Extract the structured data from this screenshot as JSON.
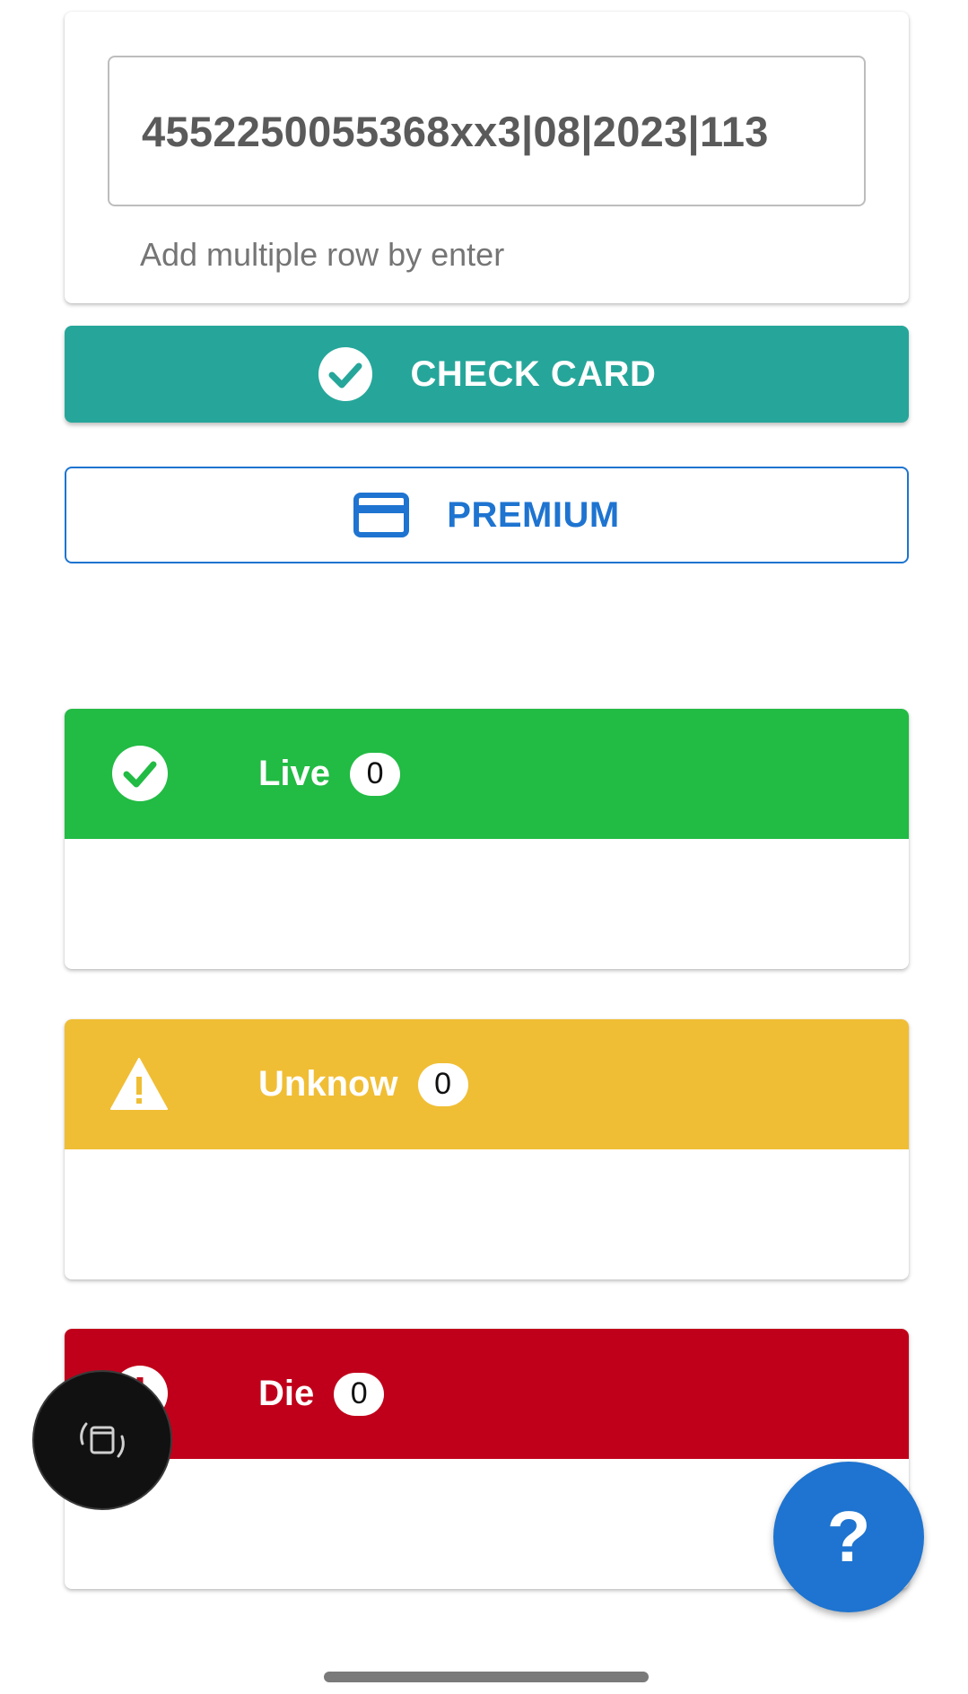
{
  "card_input": {
    "value": "4552250055368xx3|08|2023|113",
    "helper_text": "Add multiple row by enter"
  },
  "buttons": {
    "check_label": "CHECK CARD",
    "premium_label": "PREMIUM"
  },
  "status_panels": [
    {
      "label": "Live",
      "count": "0",
      "color": "#22bb44",
      "icon": "check-circle-icon"
    },
    {
      "label": "Unknow",
      "count": "0",
      "color": "#f0be35",
      "icon": "warning-icon"
    },
    {
      "label": "Die",
      "count": "0",
      "color": "#c0001a",
      "icon": "alert-circle-icon"
    }
  ],
  "fabs": {
    "help_label": "?",
    "rotate_icon": "rotate-screen-icon"
  },
  "colors": {
    "accent_teal": "#26a69a",
    "accent_blue": "#1e74d0"
  }
}
